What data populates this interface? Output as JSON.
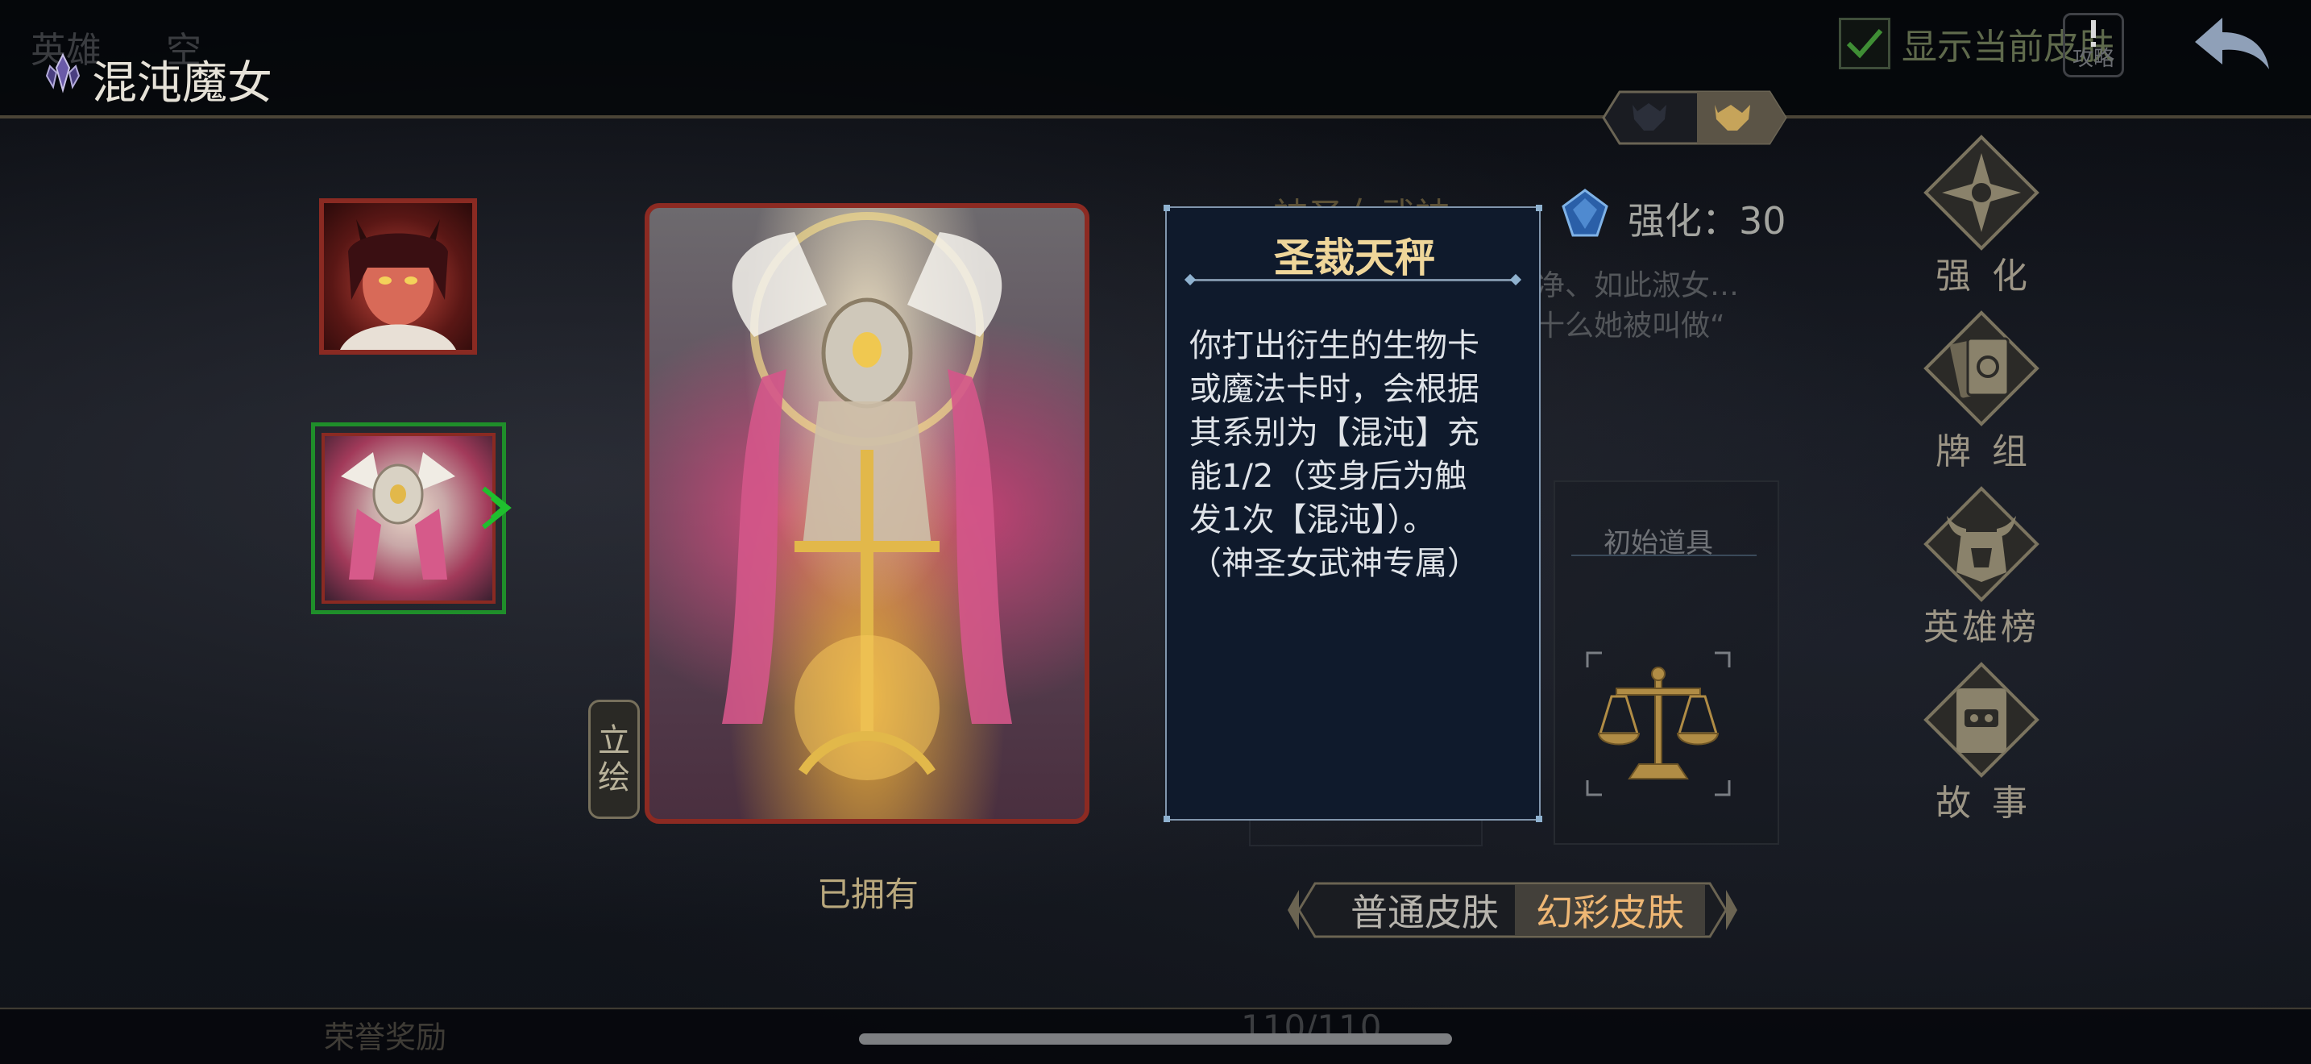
{
  "header": {
    "ghost_tabs": [
      "英雄",
      "空"
    ],
    "title": "混沌魔女",
    "show_current_skin_label": "显示当前皮肤",
    "guide_label": "攻略"
  },
  "portraits": [
    {
      "name": "red-demon-portrait",
      "selected": false
    },
    {
      "name": "valkyrie-portrait",
      "selected": true
    }
  ],
  "card": {
    "draw_tab_chars": [
      "立",
      "绘"
    ],
    "owned_label": "已拥有"
  },
  "info": {
    "skin_name": "神圣女武神",
    "enhance_label": "强化：30",
    "description_lines": [
      "净、如此淑女…",
      "十么她被叫做“"
    ],
    "initial_item_label": "初始道具"
  },
  "tooltip": {
    "title": "圣裁天秤",
    "body_lines": [
      "你打出衍生的生物卡",
      "或魔法卡时，会根据",
      "其系别为【混沌】充",
      "能1/2（变身后为触",
      "发1次【混沌】）。",
      "（神圣女武神专属）"
    ]
  },
  "skin_tabs": {
    "normal": "普通皮肤",
    "fantasy": "幻彩皮肤",
    "active": "fantasy"
  },
  "right_menu": [
    {
      "label": "强化",
      "icon": "compass-star-icon"
    },
    {
      "label": "牌组",
      "icon": "card-deck-icon"
    },
    {
      "label": "英雄榜",
      "icon": "horned-helmet-icon"
    },
    {
      "label": "故事",
      "icon": "story-book-icon"
    }
  ],
  "footer": {
    "honor_reward": "荣誉奖励",
    "count": "110/110"
  },
  "colors": {
    "accent_gold": "#efd69a",
    "selected_green": "#1f8e2a",
    "card_border": "#8c2a22",
    "tooltip_bg": "#0f1a2c"
  }
}
